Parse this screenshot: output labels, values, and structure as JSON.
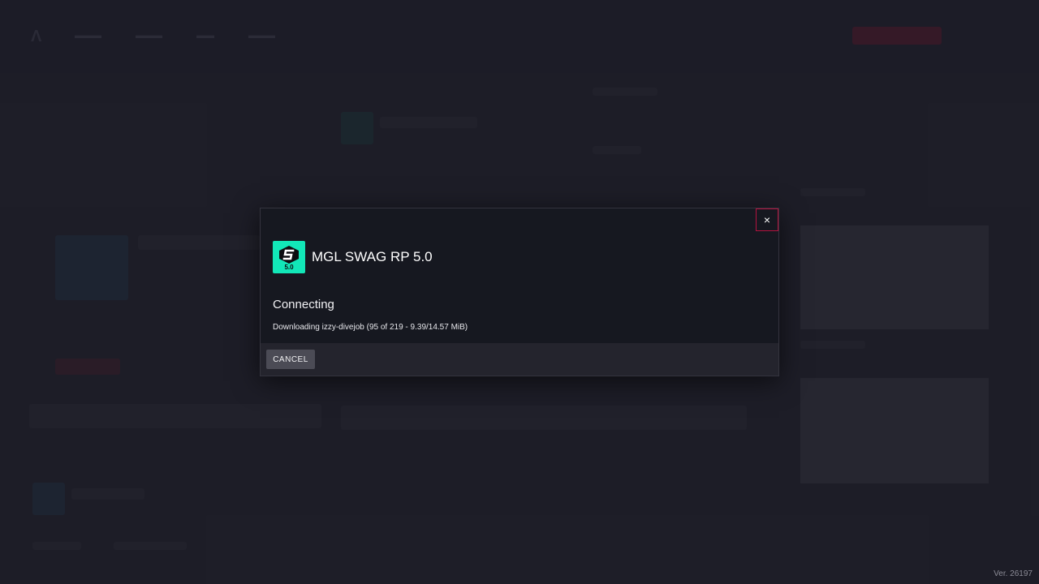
{
  "app": {
    "version": "Ver. 26197"
  },
  "dialog": {
    "server_name": "MGL SWAG RP 5.0",
    "close_glyph": "×",
    "status": "Connecting",
    "progress_text": "Downloading izzy-divejob (95 of 219 - 9.39/14.57 MiB)",
    "cancel_label": "CANCEL",
    "logo": {
      "icon": "server-logo-icon",
      "text": "5.0",
      "color": "#12e7b8"
    },
    "accent_color": "#b3123f"
  }
}
